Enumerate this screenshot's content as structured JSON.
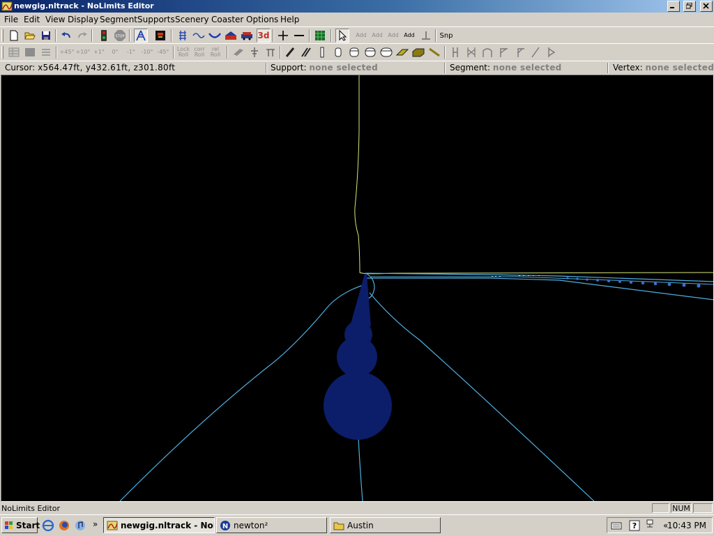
{
  "window": {
    "title": "newgig.nltrack - NoLimits Editor",
    "app_icon": "coaster-app-icon",
    "controls": [
      "minimize-icon",
      "restore-icon",
      "close-icon"
    ]
  },
  "menu": {
    "items": [
      "File",
      "Edit",
      "View",
      "Display",
      "Segment",
      "Supports",
      "Scenery",
      "Coaster",
      "Options",
      "Help"
    ]
  },
  "toolbar": {
    "snap_label": "Snp",
    "add_labels": [
      "Add",
      "Add",
      "Add",
      "Add"
    ],
    "angle_labels": [
      "+45°",
      "+10°",
      "+1°",
      "0°",
      "-1°",
      "-10°",
      "-45°"
    ],
    "lock_label": "Lock",
    "corr_label": "corr",
    "rel_label": "rel",
    "roll_label": "Roll",
    "three_d_label": "3d",
    "stop_label": "STOP"
  },
  "status": {
    "cursor_label": "Cursor:",
    "cursor_value": "x564.47ft, y432.61ft, z301.80ft",
    "support_label": "Support:",
    "support_value": "none selected",
    "segment_label": "Segment:",
    "segment_value": "none selected",
    "vertex_label": "Vertex:",
    "vertex_value": "none selected"
  },
  "viewport": {
    "background": "#000000",
    "track_color": "#4fb0e0",
    "heartline_color": "#d8e87a",
    "support_color": "#0c1e6a"
  },
  "app_status": {
    "message": "NoLimits Editor",
    "num_indicator": "NUM"
  },
  "taskbar": {
    "start_label": "Start",
    "tasks": [
      {
        "label": "newgig.nltrack - NoLi...",
        "icon": "coaster-app-icon",
        "active": true
      },
      {
        "label": "newton²",
        "icon": "newton-icon",
        "active": false
      },
      {
        "label": "Austin",
        "icon": "folder-icon",
        "active": false
      }
    ],
    "clock": "10:43 PM",
    "overflow_label": "»",
    "tray_collapse": "«"
  }
}
